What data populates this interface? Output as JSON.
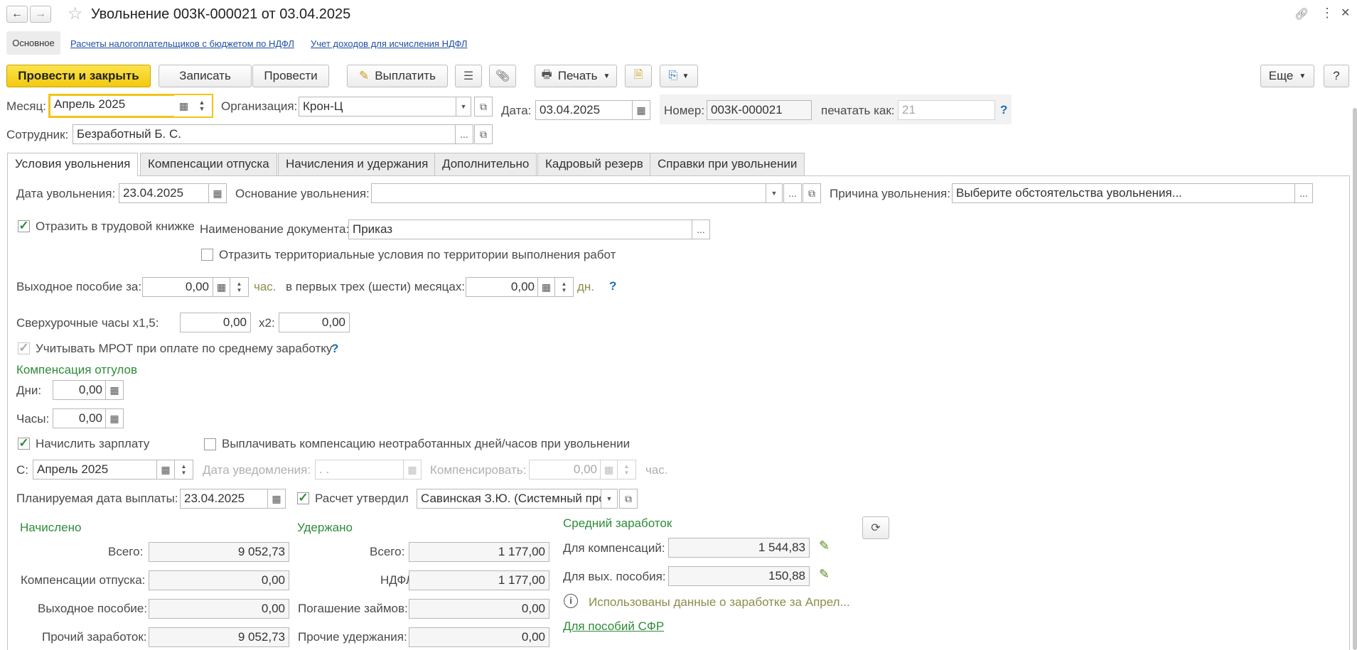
{
  "window": {
    "title": "Увольнение 003К-000021 от 03.04.2025",
    "nav_back": "←",
    "nav_forward": "→"
  },
  "form_links": {
    "main": "Основное",
    "ndfl_calc": "Расчеты налогоплательщиков с бюджетом по НДФЛ",
    "income_accounting": "Учет доходов для исчисления НДФЛ"
  },
  "toolbar": {
    "post_close": "Провести и закрыть",
    "save": "Записать",
    "post": "Провести",
    "pay": "Выплатить",
    "print": "Печать",
    "more": "Еще",
    "help": "?"
  },
  "header": {
    "month_label": "Месяц:",
    "month_value": "Апрель 2025",
    "org_label": "Организация:",
    "org_value": "Крон-Ц",
    "date_label": "Дата:",
    "date_value": "03.04.2025",
    "number_label": "Номер:",
    "number_value": "003К-000021",
    "print_as_label": "печатать как:",
    "print_as_placeholder": "21",
    "employee_label": "Сотрудник:",
    "employee_value": "Безработный Б. С."
  },
  "tabs": [
    "Условия увольнения",
    "Компенсации отпуска",
    "Начисления и удержания",
    "Дополнительно",
    "Кадровый резерв",
    "Справки при увольнении"
  ],
  "conditions": {
    "dismiss_date_label": "Дата увольнения:",
    "dismiss_date_value": "23.04.2025",
    "basis_label": "Основание увольнения:",
    "basis_value": "",
    "reason_label": "Причина увольнения:",
    "reason_value": "Выберите обстоятельства увольнения...",
    "workbook_label": "Отразить в трудовой книжке",
    "doc_name_label": "Наименование документа:",
    "doc_name_value": "Приказ",
    "territorial_label": "Отразить территориальные условия по территории выполнения работ",
    "severance_label": "Выходное пособие за:",
    "severance_hours": "0,00",
    "hours_unit": "час.",
    "first_months_label": "в первых трех (шести) месяцах:",
    "first_months_value": "0,00",
    "days_unit": "дн.",
    "overtime_label": "Сверхурочные часы х1,5:",
    "overtime_x15": "0,00",
    "x2_label": "х2:",
    "overtime_x2": "0,00",
    "mrot_label": "Учитывать МРОТ при оплате по среднему заработку",
    "comp_section": "Компенсация отгулов",
    "comp_days_label": "Дни:",
    "comp_days_value": "0,00",
    "comp_hours_label": "Часы:",
    "comp_hours_value": "0,00",
    "accrue_salary_label": "Начислить зарплату",
    "pay_unworked_label": "Выплачивать компенсацию неотработанных дней/часов при увольнении",
    "from_label": "С:",
    "from_value": "Апрель 2025",
    "notice_date_label": "Дата уведомления:",
    "notice_date_value": " .  .",
    "compensate_label": "Компенсировать:",
    "compensate_value": "0,00",
    "compensate_unit": "час.",
    "plan_date_label": "Планируемая дата выплаты:",
    "plan_date_value": "23.04.2025",
    "approved_label": "Расчет утвердил",
    "approved_value": "Савинская З.Ю. (Системный про"
  },
  "accrued": {
    "title": "Начислено",
    "total_label": "Всего:",
    "total_value": "9 052,73",
    "vacation_label": "Компенсации отпуска:",
    "vacation_value": "0,00",
    "severance_label": "Выходное пособие:",
    "severance_value": "0,00",
    "other_label": "Прочий заработок:",
    "other_value": "9 052,73"
  },
  "withheld": {
    "title": "Удержано",
    "total_label": "Всего:",
    "total_value": "1 177,00",
    "ndfl_label": "НДФЛ:",
    "ndfl_value": "1 177,00",
    "loans_label": "Погашение займов:",
    "loans_value": "0,00",
    "other_label": "Прочие удержания:",
    "other_value": "0,00"
  },
  "average": {
    "title": "Средний заработок",
    "comp_label": "Для компенсаций:",
    "comp_value": "1 544,83",
    "severance_label": "Для вых. пособия:",
    "severance_value": "150,88",
    "info_text": "Использованы данные о заработке за Апрел...",
    "sfr_link": "Для пособий СФР"
  }
}
